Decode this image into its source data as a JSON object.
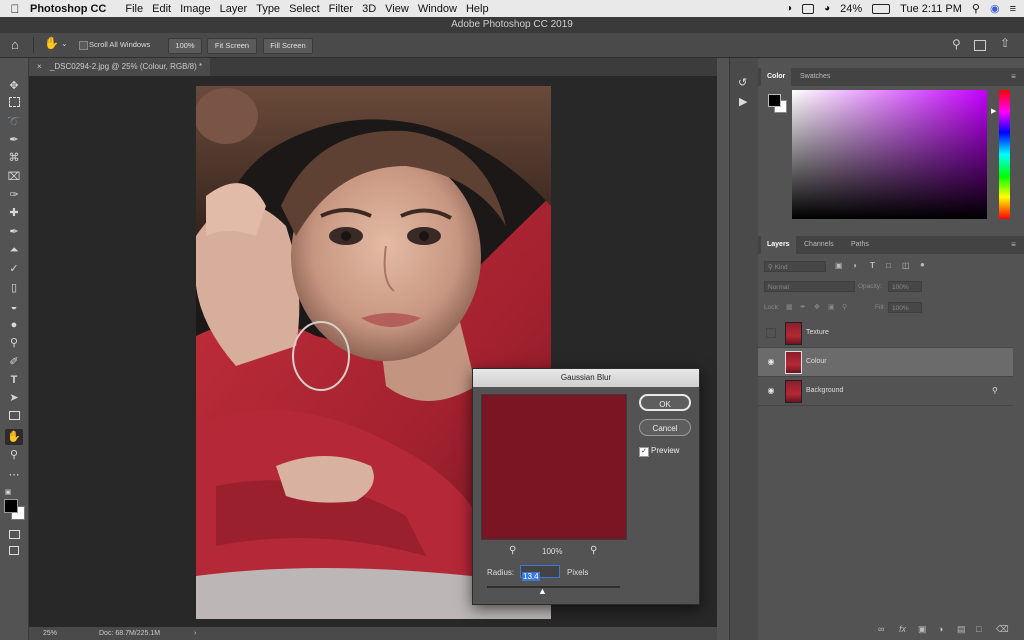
{
  "menubar": {
    "app_name": "Photoshop CC",
    "menus": [
      "File",
      "Edit",
      "Image",
      "Layer",
      "Type",
      "Select",
      "Filter",
      "3D",
      "View",
      "Window",
      "Help"
    ],
    "battery": "24%",
    "clock": "Tue 2:11 PM"
  },
  "window_title": "Adobe Photoshop CC 2019",
  "options_bar": {
    "scroll_all_windows": "Scroll All Windows",
    "zoom_100": "100%",
    "fit_screen": "Fit Screen",
    "fill_screen": "Fill Screen"
  },
  "document": {
    "tab_label": "_DSC0294-2.jpg @ 25% (Colour, RGB/8) *",
    "zoom": "25%",
    "doc_size": "Doc: 68.7M/225.1M"
  },
  "color_panel": {
    "tabs": [
      "Color",
      "Swatches"
    ]
  },
  "layers_panel": {
    "tabs": [
      "Layers",
      "Channels",
      "Paths"
    ],
    "kind_label": "Kind",
    "blend_mode": "Normal",
    "opacity_label": "Opacity:",
    "opacity_value": "100%",
    "lock_label": "Lock:",
    "fill_label": "Fill:",
    "fill_value": "100%",
    "layers": [
      {
        "name": "Texture",
        "visible": false,
        "selected": false
      },
      {
        "name": "Colour",
        "visible": true,
        "selected": true
      },
      {
        "name": "Background",
        "visible": true,
        "selected": false,
        "locked": true
      }
    ]
  },
  "dialog": {
    "title": "Gaussian Blur",
    "ok": "OK",
    "cancel": "Cancel",
    "preview_label": "Preview",
    "preview_checked": true,
    "zoom": "100%",
    "radius_label": "Radius:",
    "radius_value": "13.4",
    "radius_unit": "Pixels",
    "preview_color": "#7a1624"
  },
  "colors": {
    "accent_blue": "#3b78d8",
    "shirt_red": "#b62935"
  }
}
